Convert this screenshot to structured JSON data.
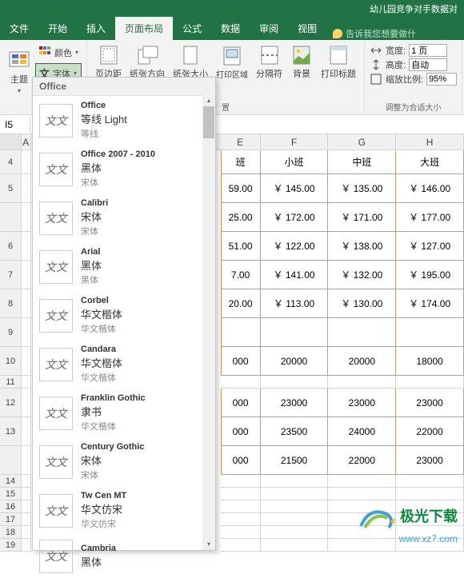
{
  "titlebar": {
    "doc_title": "幼儿园竞争对手数据对"
  },
  "tabs": {
    "file": "文件",
    "home": "开始",
    "insert": "插入",
    "layout": "页面布局",
    "formulas": "公式",
    "data": "数据",
    "review": "审阅",
    "view": "视图",
    "tell_me": "告诉我您想要做什"
  },
  "ribbon": {
    "themes": {
      "label": "主题",
      "colors": "颜色",
      "fonts": "字体"
    },
    "page_setup": {
      "margins": "页边距",
      "orientation": "纸张方向",
      "size": "纸张大小",
      "print_area": "打印区域",
      "breaks": "分隔符",
      "background": "背景",
      "print_titles": "打印标题",
      "group_label": "置"
    },
    "scale": {
      "width_label": "宽度:",
      "width_value": "1 页",
      "height_label": "高度:",
      "height_value": "自动",
      "scale_label": "缩放比例:",
      "scale_value": "95%",
      "group_label": "调整为合适大小"
    }
  },
  "namebox": {
    "ref": "I5"
  },
  "font_dropdown": {
    "header": "Office",
    "preview_text": "文文",
    "items": [
      {
        "group": "Office",
        "display1": "等线 Light",
        "display2": "等线"
      },
      {
        "group": "Office 2007 - 2010",
        "display1": "黑体",
        "display2": "宋体"
      },
      {
        "group": "Calibri",
        "display1": "宋体",
        "display2": "宋体"
      },
      {
        "group": "Arial",
        "display1": "黑体",
        "display2": "黑体"
      },
      {
        "group": "Corbel",
        "display1": "华文楷体",
        "display2": "华文楷体"
      },
      {
        "group": "Candara",
        "display1": "华文楷体",
        "display2": "华文楷体"
      },
      {
        "group": "Franklin Gothic",
        "display1": "隶书",
        "display2": "华文楷体"
      },
      {
        "group": "Century Gothic",
        "display1": "宋体",
        "display2": "宋体"
      },
      {
        "group": "Tw Cen MT",
        "display1": "华文仿宋",
        "display2": "华文仿宋"
      },
      {
        "group": "Cambria",
        "display1": "黑体",
        "display2": ""
      }
    ]
  },
  "sheet": {
    "columns": [
      "A",
      "E",
      "F",
      "G",
      "H"
    ],
    "col_widths": {
      "A": 12,
      "E": 80,
      "F": 88,
      "G": 88,
      "H": 88
    },
    "row_heights": {
      "r4": 30,
      "r5": 36,
      "r5b": 36,
      "r6": 36,
      "r7": 36,
      "r8": 36,
      "r9": 36,
      "r10": 36,
      "r11": 16,
      "r12": 36,
      "r13": 36,
      "r13b": 36,
      "r14": 16,
      "r15": 16,
      "r16": 16,
      "r17": 16,
      "r18": 16,
      "r19": 16
    },
    "headers_row4": {
      "E": "班",
      "F": "小班",
      "G": "中班",
      "H": "大班"
    },
    "rows": [
      {
        "n": "5",
        "E": "59.00",
        "F": "￥ 145.00",
        "G": "￥ 135.00",
        "H": "￥ 146.00"
      },
      {
        "n": "",
        "E": "25.00",
        "F": "￥ 172.00",
        "G": "￥ 171.00",
        "H": "￥ 177.00"
      },
      {
        "n": "6",
        "E": "51.00",
        "F": "￥ 122.00",
        "G": "￥ 138.00",
        "H": "￥ 127.00"
      },
      {
        "n": "7",
        "E": "7.00",
        "F": "￥ 141.00",
        "G": "￥ 132.00",
        "H": "￥ 195.00"
      },
      {
        "n": "8",
        "E": "20.00",
        "F": "￥ 113.00",
        "G": "￥ 130.00",
        "H": "￥ 174.00"
      },
      {
        "n": "9",
        "E": "",
        "F": "",
        "G": "",
        "H": ""
      }
    ],
    "section2": [
      {
        "n": "10",
        "E": "000",
        "F": "20000",
        "G": "20000",
        "H": "18000"
      },
      {
        "n": "11",
        "E": "",
        "F": "",
        "G": "",
        "H": ""
      },
      {
        "n": "12",
        "E": "000",
        "F": "23000",
        "G": "23000",
        "H": "23000"
      },
      {
        "n": "13",
        "E": "000",
        "F": "23500",
        "G": "24000",
        "H": "22000"
      },
      {
        "n": "",
        "E": "000",
        "F": "21500",
        "G": "22000",
        "H": "23000"
      }
    ],
    "tail_rows": [
      "14",
      "15",
      "16",
      "17",
      "18",
      "19"
    ]
  },
  "watermark": {
    "brand": "极光下载",
    "url": "www.xz7.com"
  }
}
